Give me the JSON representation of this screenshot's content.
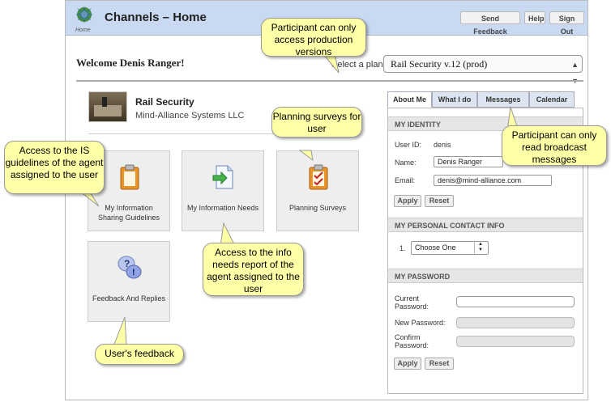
{
  "header": {
    "logo_text": "Home",
    "title": "Channels – Home",
    "buttons": [
      "Send Feedback",
      "Help",
      "Sign Out"
    ]
  },
  "welcome": "Welcome Denis Ranger!",
  "plan": {
    "label": "Select a plan:",
    "selected": "Rail Security v.12 (prod)"
  },
  "project": {
    "name": "Rail Security",
    "org": "Mind-Alliance Systems LLC"
  },
  "tiles": [
    {
      "label": "My Information Sharing Guidelines",
      "icon": "clipboard-icon"
    },
    {
      "label": "My Information Needs",
      "icon": "document-arrow-icon"
    },
    {
      "label": "Planning Surveys",
      "icon": "checklist-icon"
    },
    {
      "label": "Feedback And Replies",
      "icon": "question-bubbles-icon"
    }
  ],
  "tabs": [
    "About Me",
    "What I do",
    "Messages",
    "Calendar"
  ],
  "identity": {
    "heading": "MY IDENTITY",
    "user_id_label": "User ID:",
    "user_id": "denis",
    "name_label": "Name:",
    "name_value": "Denis Ranger",
    "email_label": "Email:",
    "email_value": "denis@mind-alliance.com",
    "apply": "Apply",
    "reset": "Reset"
  },
  "contact": {
    "heading": "MY PERSONAL CONTACT INFO",
    "index": "1.",
    "choose": "Choose One"
  },
  "password": {
    "heading": "MY PASSWORD",
    "current_label": "Current Password:",
    "new_label": "New Password:",
    "confirm_label": "Confirm Password:",
    "apply": "Apply",
    "reset": "Reset"
  },
  "callouts": {
    "production": "Participant can only access production versions",
    "planning": "Planning surveys for user",
    "broadcast": "Participant can only read broadcast messages",
    "guidelines": "Access to the IS guidelines of the agent assigned to the user",
    "needs": "Access to the info needs report of the agent assigned to the user",
    "feedback": "User's feedback"
  },
  "colors": {
    "header_bg": "#c9d9f2",
    "callout_bg": "#ffffa8",
    "tile_bg": "#eeeeee"
  }
}
